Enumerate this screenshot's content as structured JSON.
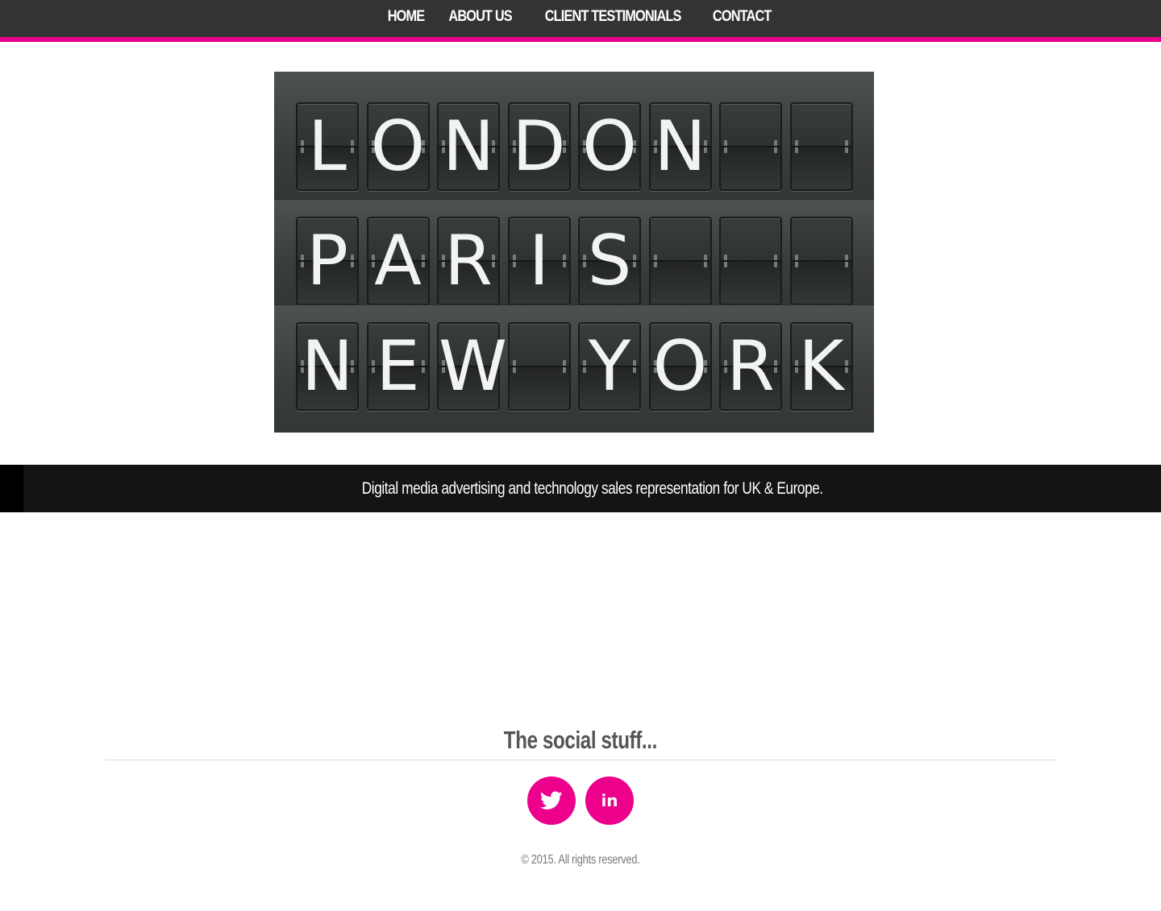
{
  "nav": {
    "items": [
      {
        "label": "HOME"
      },
      {
        "label": "ABOUT US"
      },
      {
        "label": "CLIENT TESTIMONIALS"
      },
      {
        "label": "CONTACT"
      }
    ]
  },
  "hero": {
    "rows": [
      [
        "L",
        "O",
        "N",
        "D",
        "O",
        "N",
        "",
        ""
      ],
      [
        "P",
        "A",
        "R",
        "I",
        "S",
        "",
        "",
        ""
      ],
      [
        "N",
        "E",
        "W",
        "",
        "Y",
        "O",
        "R",
        "K"
      ]
    ]
  },
  "tagline": "Digital media advertising and technology sales representation for UK & Europe.",
  "social": {
    "title": "The social stuff...",
    "icons": [
      {
        "name": "twitter-icon"
      },
      {
        "name": "linkedin-icon",
        "text": "in"
      }
    ]
  },
  "footer": {
    "copyright": "© 2015. All rights reserved."
  },
  "colors": {
    "accent": "#ec008c",
    "nav_bg": "#333333",
    "tagline_bg": "#141414"
  }
}
